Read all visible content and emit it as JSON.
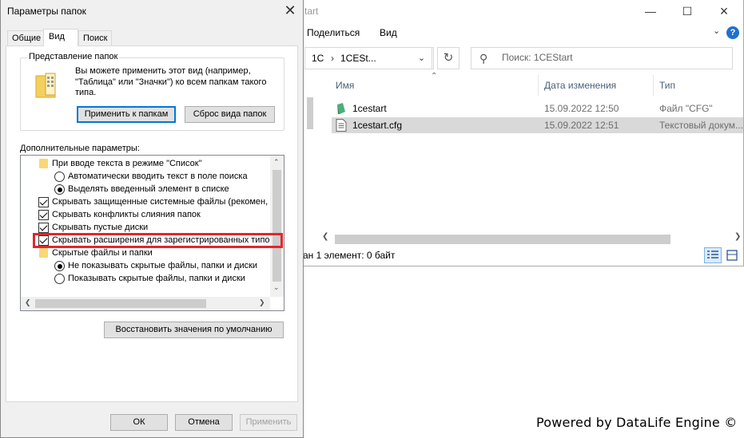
{
  "explorer": {
    "title_fragment": "tart",
    "menu": {
      "share": "Поделиться",
      "view": "Вид"
    },
    "address": {
      "part1": "1С",
      "sep": "›",
      "part2": "1CESt..."
    },
    "search_placeholder": "Поиск: 1CEStart",
    "columns": {
      "name": "Имя",
      "date": "Дата изменения",
      "type": "Тип"
    },
    "files": [
      {
        "name": "1cestart",
        "date": "15.09.2022 12:50",
        "type": "Файл \"CFG\""
      },
      {
        "name": "1cestart.cfg",
        "date": "15.09.2022 12:51",
        "type": "Текстовый докум..."
      }
    ],
    "status": "ан 1 элемент: 0 байт"
  },
  "dialog": {
    "title": "Параметры папок",
    "tabs": [
      "Общие",
      "Вид",
      "Поиск"
    ],
    "folder_views": {
      "label": "Представление папок",
      "text": "Вы можете применить этот вид (например, \"Таблица\" или \"Значки\") ко всем папкам такого типа.",
      "apply_button": "Применить к папкам",
      "reset_button": "Сброс вида папок"
    },
    "advanced_label": "Дополнительные параметры:",
    "settings": [
      {
        "kind": "folder",
        "label": "При вводе текста в режиме \"Список\""
      },
      {
        "kind": "radio",
        "checked": false,
        "label": "Автоматически вводить текст в поле поиска"
      },
      {
        "kind": "radio",
        "checked": true,
        "label": "Выделять введенный элемент в списке"
      },
      {
        "kind": "check",
        "checked": true,
        "label": "Скрывать защищенные системные файлы (рекомен,"
      },
      {
        "kind": "check",
        "checked": true,
        "label": "Скрывать конфликты слияния папок"
      },
      {
        "kind": "check",
        "checked": true,
        "label": "Скрывать пустые диски"
      },
      {
        "kind": "check",
        "checked": true,
        "label": "Скрывать расширения для зарегистрированных типо"
      },
      {
        "kind": "folder",
        "label": "Скрытые файлы и папки"
      },
      {
        "kind": "radio",
        "checked": true,
        "label": "Не показывать скрытые файлы, папки и диски"
      },
      {
        "kind": "radio",
        "checked": false,
        "label": "Показывать скрытые файлы, папки и диски"
      }
    ],
    "restore_button": "Восстановить значения по умолчанию",
    "ok_button": "ОК",
    "cancel_button": "Отмена",
    "apply_button": "Применить"
  },
  "watermark": "Powered by DataLife Engine ©",
  "colors": {
    "highlight": "#e3262a",
    "accent": "#0078d7",
    "selected_row": "#d9d9d9"
  }
}
